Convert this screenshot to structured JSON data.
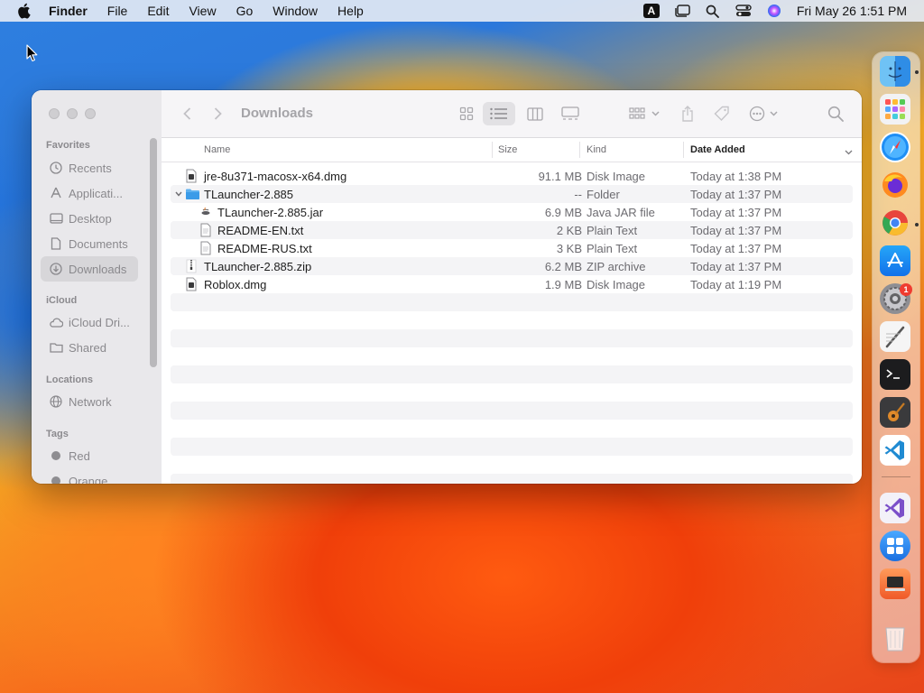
{
  "menubar": {
    "app_name": "Finder",
    "menus": [
      "File",
      "Edit",
      "View",
      "Go",
      "Window",
      "Help"
    ],
    "input_badge": "A",
    "clock": "Fri May 26  1:51 PM"
  },
  "window": {
    "title": "Downloads",
    "sidebar": {
      "favorites_header": "Favorites",
      "favorites": [
        {
          "label": "Recents",
          "icon": "clock-icon"
        },
        {
          "label": "Applicati...",
          "icon": "applications-icon"
        },
        {
          "label": "Desktop",
          "icon": "desktop-icon"
        },
        {
          "label": "Documents",
          "icon": "document-icon"
        },
        {
          "label": "Downloads",
          "icon": "download-icon",
          "selected": true
        }
      ],
      "icloud_header": "iCloud",
      "icloud": [
        {
          "label": "iCloud Dri...",
          "icon": "cloud-icon"
        },
        {
          "label": "Shared",
          "icon": "shared-folder-icon"
        }
      ],
      "locations_header": "Locations",
      "locations": [
        {
          "label": "Network",
          "icon": "globe-icon"
        }
      ],
      "tags_header": "Tags",
      "tags": [
        {
          "label": "Red",
          "color": "#8e8d91"
        },
        {
          "label": "Orange",
          "color": "#8e8d91"
        }
      ]
    },
    "columns": {
      "name": "Name",
      "size": "Size",
      "kind": "Kind",
      "date_added": "Date Added"
    },
    "files": [
      {
        "name": "jre-8u371-macosx-x64.dmg",
        "size": "91.1 MB",
        "kind": "Disk Image",
        "date": "Today at 1:38 PM",
        "icon": "disk-image-icon",
        "indent": 0
      },
      {
        "name": "TLauncher-2.885",
        "size": "--",
        "kind": "Folder",
        "date": "Today at 1:37 PM",
        "icon": "folder-icon",
        "indent": 0,
        "expanded": true
      },
      {
        "name": "TLauncher-2.885.jar",
        "size": "6.9 MB",
        "kind": "Java JAR file",
        "date": "Today at 1:37 PM",
        "icon": "jar-icon",
        "indent": 1
      },
      {
        "name": "README-EN.txt",
        "size": "2 KB",
        "kind": "Plain Text",
        "date": "Today at 1:37 PM",
        "icon": "text-file-icon",
        "indent": 1
      },
      {
        "name": "README-RUS.txt",
        "size": "3 KB",
        "kind": "Plain Text",
        "date": "Today at 1:37 PM",
        "icon": "text-file-icon",
        "indent": 1
      },
      {
        "name": "TLauncher-2.885.zip",
        "size": "6.2 MB",
        "kind": "ZIP archive",
        "date": "Today at 1:37 PM",
        "icon": "zip-icon",
        "indent": 0
      },
      {
        "name": "Roblox.dmg",
        "size": "1.9 MB",
        "kind": "Disk Image",
        "date": "Today at 1:19 PM",
        "icon": "disk-image-icon",
        "indent": 0
      }
    ]
  },
  "dock": {
    "apps": [
      {
        "name": "finder-icon",
        "running": true
      },
      {
        "name": "launchpad-icon"
      },
      {
        "name": "safari-icon"
      },
      {
        "name": "firefox-icon"
      },
      {
        "name": "chrome-icon",
        "running": true
      },
      {
        "name": "app-store-icon"
      },
      {
        "name": "system-settings-icon",
        "badge": "1"
      },
      {
        "name": "script-editor-icon"
      },
      {
        "name": "terminal-icon"
      },
      {
        "name": "garageband-icon"
      },
      {
        "name": "vscode-icon"
      },
      {
        "name": "visual-studio-icon"
      },
      {
        "name": "app-folder-icon"
      },
      {
        "name": "screen-sharing-icon"
      },
      {
        "name": "trash-icon"
      }
    ]
  }
}
